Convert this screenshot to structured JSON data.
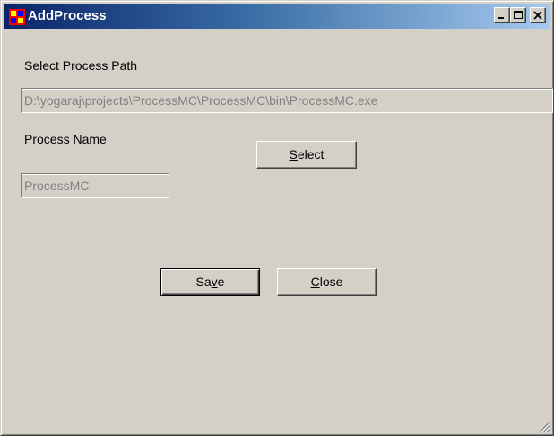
{
  "window": {
    "title": "AddProcess"
  },
  "form": {
    "process_path_label": "Select Process Path",
    "process_path_value": "D:\\yogaraj\\projects\\ProcessMC\\ProcessMC\\bin\\ProcessMC.exe",
    "process_name_label": "Process Name",
    "process_name_value": "ProcessMC"
  },
  "buttons": {
    "select": {
      "mnemonic": "S",
      "rest": "elect"
    },
    "save": {
      "pre": "Sa",
      "mnemonic": "v",
      "rest": "e"
    },
    "close": {
      "mnemonic": "C",
      "rest": "lose"
    }
  },
  "icons": {
    "app": "app-window-icon",
    "minimize": "minimize-icon",
    "maximize": "maximize-icon",
    "close": "close-icon",
    "grip": "resize-grip-icon"
  }
}
